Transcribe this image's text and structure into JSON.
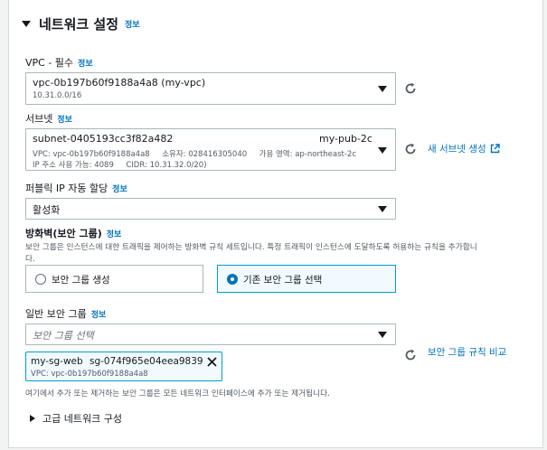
{
  "section": {
    "title": "네트워크 설정",
    "info": "정보"
  },
  "vpc": {
    "label": "VPC - 필수",
    "info": "정보",
    "value": "vpc-0b197b60f9188a4a8 (my-vpc)",
    "cidr": "10.31.0.0/16"
  },
  "subnet": {
    "label": "서브넷",
    "info": "정보",
    "value": "subnet-0405193cc3f82a482",
    "name": "my-pub-2c",
    "line2": "VPC: vpc-0b197b60f9188a4a8     소유자: 028416305040     가용 영역: ap-northeast-2c",
    "line3": "IP 주소 사용 가능: 4089     CIDR: 10.31.32.0/20)",
    "create_link": "새 서브넷 생성"
  },
  "public_ip": {
    "label": "퍼블릭 IP 자동 할당",
    "info": "정보",
    "value": "활성화"
  },
  "firewall": {
    "label": "방화벽(보안 그룹)",
    "info": "정보",
    "desc_line1": "보안 그룹은 인스턴스에 대한 트래픽을 제어하는 방화벽 규칙 세트입니다. 특정 트래픽이 인스턴스에 도달하도록 허용하는 규칙을 추가합니",
    "desc_line2": "다.",
    "option_create": "보안 그룹 생성",
    "option_existing": "기존 보안 그룹 선택"
  },
  "common_sg": {
    "label": "일반 보안 그룹",
    "info": "정보",
    "placeholder": "보안 그룹 선택",
    "compare_link": "보안 그룹 규칙 비교",
    "token_name": "my-sg-web",
    "token_id": "sg-074f965e04eea9839",
    "token_vpc": "VPC: vpc-0b197b60f9188a4a8",
    "hint": "여기에서 추가 또는 제거하는 보안 그룹은 모든 네트워크 인터페이스에 추가 또는 제거됩니다."
  },
  "advanced": {
    "label": "고급 네트워크 구성"
  },
  "colors": {
    "accent": "#0073bb",
    "selected_border": "#00a1c9",
    "selected_bg": "#f1faff"
  }
}
